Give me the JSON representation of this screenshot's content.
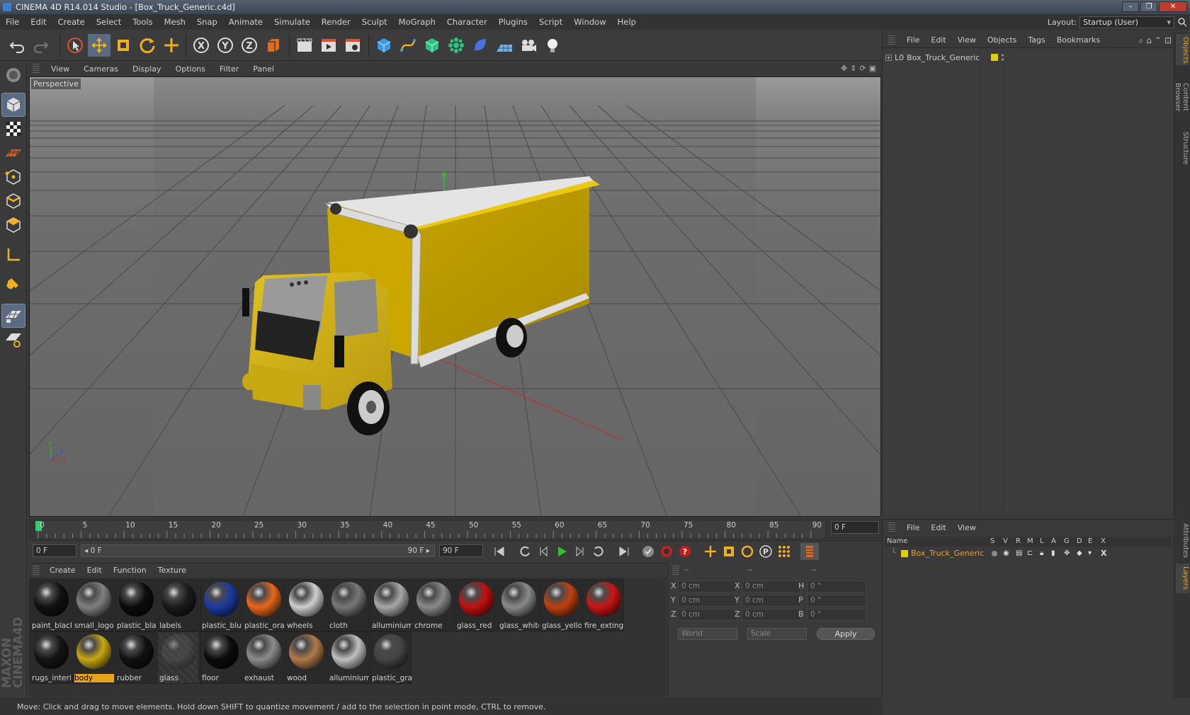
{
  "window": {
    "title": "CINEMA 4D R14.014 Studio - [Box_Truck_Generic.c4d]",
    "controls": [
      "–",
      "❐",
      "✕"
    ]
  },
  "menubar": {
    "items": [
      "File",
      "Edit",
      "Create",
      "Select",
      "Tools",
      "Mesh",
      "Snap",
      "Animate",
      "Simulate",
      "Render",
      "Sculpt",
      "MoGraph",
      "Character",
      "Plugins",
      "Script",
      "Window",
      "Help"
    ],
    "layout_label": "Layout:",
    "layout_value": "Startup (User)"
  },
  "viewport": {
    "menu": [
      "View",
      "Cameras",
      "Display",
      "Options",
      "Filter",
      "Panel"
    ],
    "label": "Perspective"
  },
  "timeline": {
    "ticks": [
      "0",
      "5",
      "10",
      "15",
      "20",
      "25",
      "30",
      "35",
      "40",
      "45",
      "50",
      "55",
      "60",
      "65",
      "70",
      "75",
      "80",
      "85",
      "90"
    ],
    "current_frame": "0 F",
    "start_frame": "0 F",
    "range_start": "◂ 0 F",
    "range_end": "90 F ▸",
    "end_frame": "90 F",
    "end_frame_right": "0 F"
  },
  "materials": {
    "menu": [
      "Create",
      "Edit",
      "Function",
      "Texture"
    ],
    "items": [
      {
        "name": "paint_black",
        "color": "#111111"
      },
      {
        "name": "small_logo",
        "color": "#808080"
      },
      {
        "name": "plastic_black",
        "color": "#0c0c0c"
      },
      {
        "name": "labels",
        "color": "#1a1a1a"
      },
      {
        "name": "plastic_blue",
        "color": "#1c3aa0"
      },
      {
        "name": "plastic_orange",
        "color": "#e8661c"
      },
      {
        "name": "wheels",
        "color": "#cfcfcf"
      },
      {
        "name": "cloth",
        "color": "#777777"
      },
      {
        "name": "alluminium",
        "color": "#a8a8a8"
      },
      {
        "name": "chrome",
        "color": "#8a8a8a"
      },
      {
        "name": "glass_red",
        "color": "#c01010"
      },
      {
        "name": "glass_white",
        "color": "#8a8a8a"
      },
      {
        "name": "glass_yellow",
        "color": "#c04010"
      },
      {
        "name": "fire_extinguisher",
        "color": "#c81414"
      },
      {
        "name": "rugs_interior",
        "color": "#141414"
      },
      {
        "name": "body",
        "color": "#c8a812"
      },
      {
        "name": "rubber",
        "color": "#111111"
      },
      {
        "name": "glass",
        "color": "#555555"
      },
      {
        "name": "floor",
        "color": "#0c0c0c"
      },
      {
        "name": "exhaust",
        "color": "#8c8c8c"
      },
      {
        "name": "wood",
        "color": "#b07a4a"
      },
      {
        "name": "alluminium",
        "color": "#c0c0c0"
      },
      {
        "name": "plastic_gray",
        "color": "#444444"
      }
    ]
  },
  "coordinates": {
    "headers": [
      "--",
      "--",
      "--"
    ],
    "rows": [
      {
        "a1": "X",
        "v1": "0 cm",
        "a2": "X",
        "v2": "0 cm",
        "a3": "H",
        "v3": "0 °"
      },
      {
        "a1": "Y",
        "v1": "0 cm",
        "a2": "Y",
        "v2": "0 cm",
        "a3": "P",
        "v3": "0 °"
      },
      {
        "a1": "Z",
        "v1": "0 cm",
        "a2": "Z",
        "v2": "0 cm",
        "a3": "B",
        "v3": "0 °"
      }
    ],
    "mode1": "World",
    "mode2": "Scale",
    "apply": "Apply"
  },
  "objects": {
    "menu": [
      "File",
      "Edit",
      "View",
      "Objects",
      "Tags",
      "Bookmarks"
    ],
    "root": "Box_Truck_Generic"
  },
  "layers": {
    "menu": [
      "File",
      "Edit",
      "View"
    ],
    "columns": [
      "Name",
      "S",
      "V",
      "R",
      "M",
      "L",
      "A",
      "G",
      "D",
      "E",
      "X"
    ],
    "row": "Box_Truck_Generic"
  },
  "sidetabs": [
    "Objects",
    "Content Browser",
    "Structure",
    "Attributes",
    "Layers"
  ],
  "status": "Move: Click and drag to move elements. Hold down SHIFT to quantize movement / add to the selection in point mode, CTRL to remove."
}
